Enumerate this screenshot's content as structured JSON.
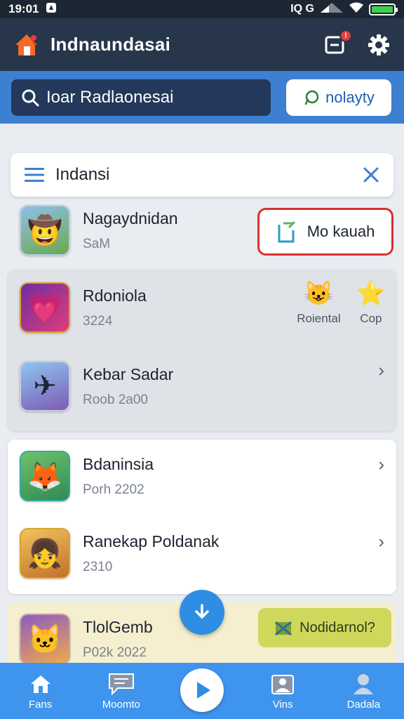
{
  "status": {
    "time": "19:01",
    "network": "IQ G"
  },
  "appbar": {
    "title": "Indnaundasai"
  },
  "search": {
    "placeholder": "Ioar Radlaonesai",
    "pill_label": "nolayty"
  },
  "filter": {
    "label": "Indansi"
  },
  "top_item": {
    "title": "Nagaydnidan",
    "subtitle": "SaM",
    "action_label": "Mo kauah"
  },
  "grey_card": {
    "items": [
      {
        "title": "Rdoniola",
        "subtitle": "3224"
      },
      {
        "title": "Kebar Sadar",
        "subtitle": "Roob 2a00"
      }
    ],
    "mini_actions": [
      {
        "label": "Roiental",
        "icon": "monster-icon"
      },
      {
        "label": "Cop",
        "icon": "star-icon"
      }
    ]
  },
  "white_card": {
    "items": [
      {
        "title": "Bdaninsia",
        "subtitle": "Porh 2202"
      },
      {
        "title": "Ranekap Poldanak",
        "subtitle": "2310"
      }
    ]
  },
  "cream_card": {
    "title": "TlolGemb",
    "subtitle": "P02k 2022",
    "action_label": "Nodidarnol?"
  },
  "bottom_nav": [
    {
      "label": "Fans",
      "icon": "home-icon"
    },
    {
      "label": "Moomto",
      "icon": "chat-icon"
    },
    {
      "label": "Vins",
      "icon": "gallery-icon"
    },
    {
      "label": "Dadala",
      "icon": "profile-icon"
    }
  ]
}
